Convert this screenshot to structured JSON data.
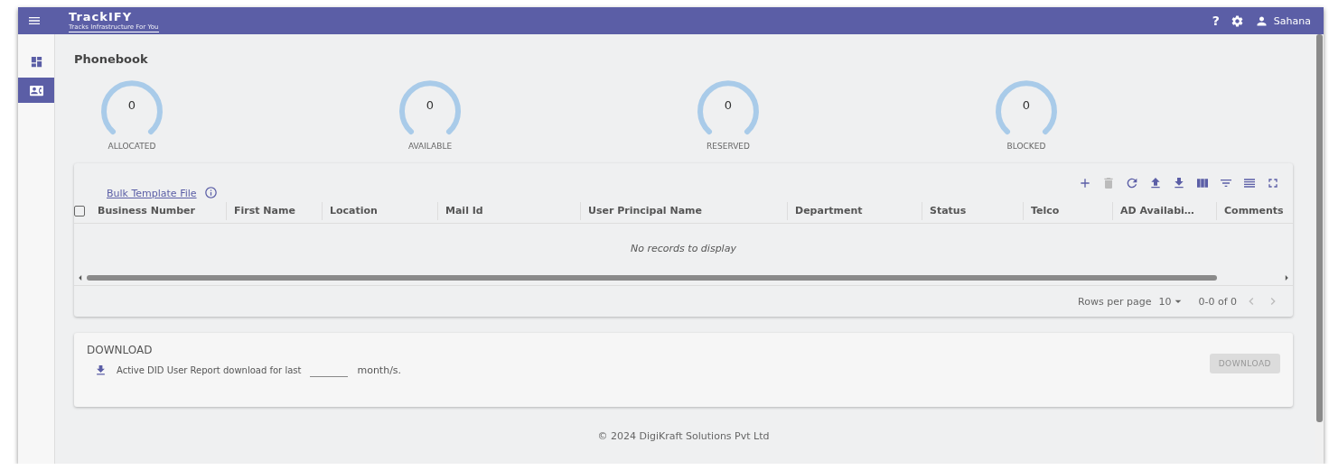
{
  "header": {
    "logo": "TrackIFY",
    "tagline": "Tracks Infrastructure For You",
    "help": "?",
    "user": "Sahana"
  },
  "sidebar": {
    "items": [
      {
        "kind": "dashboard",
        "selected": false
      },
      {
        "kind": "contacts",
        "selected": true
      }
    ]
  },
  "page_title": "Phonebook",
  "stats": [
    {
      "value": "0",
      "label": "ALLOCATED"
    },
    {
      "value": "0",
      "label": "AVAILABLE"
    },
    {
      "value": "0",
      "label": "RESERVED"
    },
    {
      "value": "0",
      "label": "BLOCKED"
    }
  ],
  "table": {
    "template_link": "Bulk Template File",
    "toolbar": [
      {
        "kind": "add",
        "disabled": false
      },
      {
        "kind": "delete",
        "disabled": true
      },
      {
        "kind": "refresh",
        "disabled": false
      },
      {
        "kind": "upload",
        "disabled": false
      },
      {
        "kind": "download",
        "disabled": false
      },
      {
        "kind": "columns",
        "disabled": false
      },
      {
        "kind": "filter",
        "disabled": false
      },
      {
        "kind": "density",
        "disabled": false
      },
      {
        "kind": "fullscreen",
        "disabled": false
      }
    ],
    "select_all": {
      "checked": false
    },
    "columns": [
      "Business Number",
      "First Name",
      "Location",
      "Mail Id",
      "User Principal Name",
      "Department",
      "Status",
      "Telco",
      "AD Availabi…",
      "Comments"
    ],
    "empty_message": "No records to display",
    "pagination": {
      "rows_label": "Rows per page",
      "rows_value": "10",
      "range": "0-0 of 0"
    }
  },
  "download": {
    "title": "DOWNLOAD",
    "text": "Active DID User Report download for last",
    "unit": "month/s.",
    "button": {
      "label": "DOWNLOAD",
      "disabled": true
    }
  },
  "footer": {
    "copyright": "© 2024 DigiKraft Solutions Pvt Ltd"
  }
}
